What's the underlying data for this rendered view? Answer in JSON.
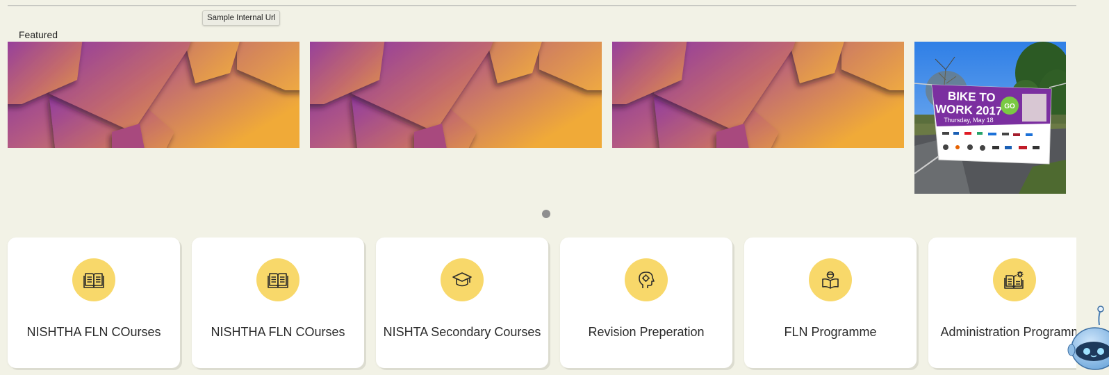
{
  "tooltip": {
    "text": "Sample Internal Url"
  },
  "featured": {
    "label": "Featured"
  },
  "photo": {
    "banner_title": "BIKE TO WORK 2017",
    "banner_date": "Thursday, May 18",
    "badge": "GO"
  },
  "colors": {
    "background": "#f2f2e6",
    "icon_circle": "#f8d86a",
    "banner_gradient_start": "#7a2aa8",
    "banner_gradient_end": "#f0aa38",
    "carousel_dot": "#8f8f8f"
  },
  "categories": [
    {
      "label": "NISHTHA FLN COurses",
      "icon": "open-book-icon"
    },
    {
      "label": "NISHTHA FLN COurses",
      "icon": "open-book-icon"
    },
    {
      "label": "NISHTA Secondary Courses",
      "icon": "graduation-cap-icon"
    },
    {
      "label": "Revision Preperation",
      "icon": "head-gear-icon"
    },
    {
      "label": "FLN Programme",
      "icon": "reader-icon"
    },
    {
      "label": "Administration Programme",
      "icon": "book-gear-icon"
    }
  ]
}
